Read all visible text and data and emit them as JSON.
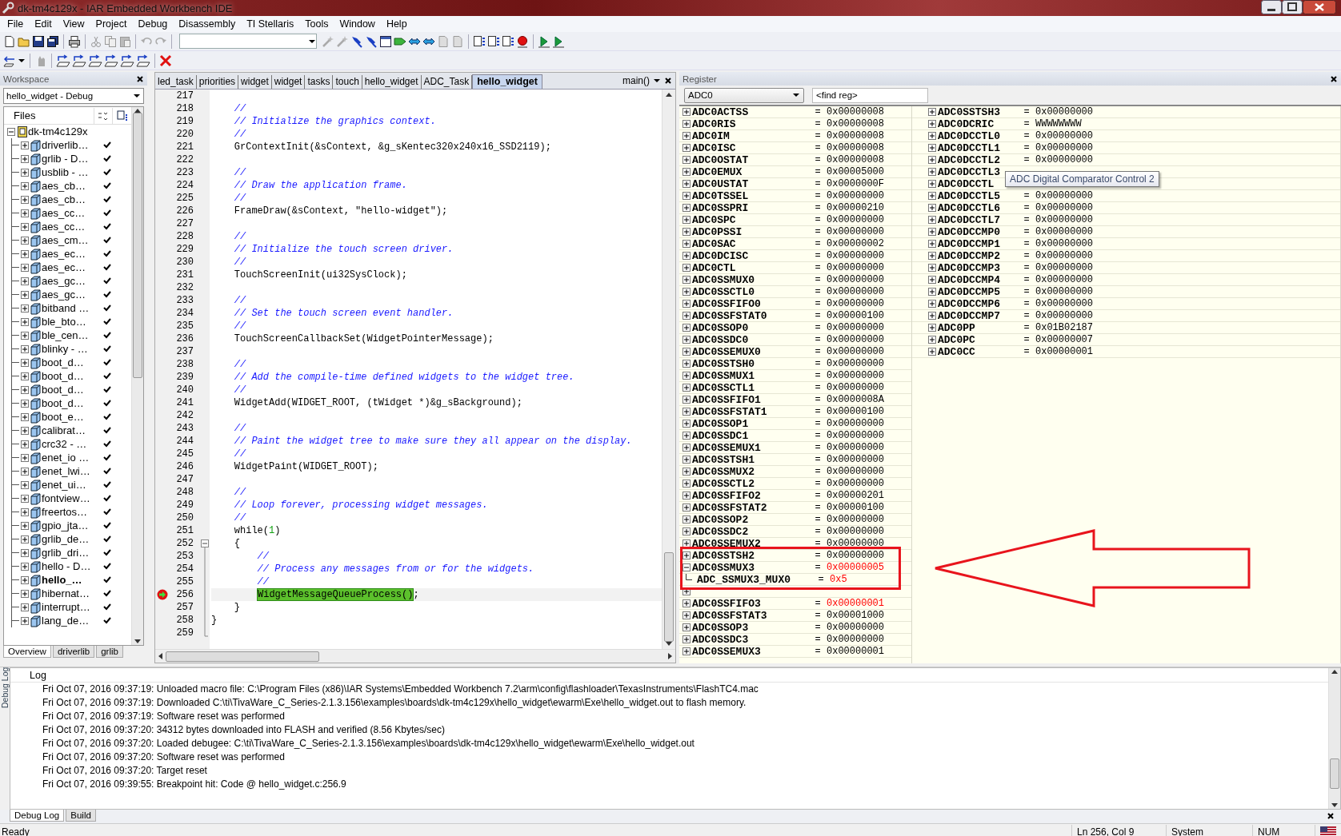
{
  "window": {
    "title": "dk-tm4c129x - IAR Embedded Workbench IDE"
  },
  "menu": [
    "File",
    "Edit",
    "View",
    "Project",
    "Debug",
    "Disassembly",
    "TI Stellaris",
    "Tools",
    "Window",
    "Help"
  ],
  "workspace": {
    "title": "Workspace",
    "configuration": "hello_widget - Debug",
    "column": "Files",
    "tree": {
      "label": "dk-tm4c129x",
      "expanded": true,
      "children": [
        {
          "label": "driverlib…",
          "active": false,
          "checked": true
        },
        {
          "label": "grlib - D…",
          "active": false,
          "checked": true
        },
        {
          "label": "usblib - …",
          "active": false,
          "checked": true
        },
        {
          "label": "aes_cb…",
          "active": false,
          "checked": true
        },
        {
          "label": "aes_cb…",
          "active": false,
          "checked": true
        },
        {
          "label": "aes_cc…",
          "active": false,
          "checked": true
        },
        {
          "label": "aes_cc…",
          "active": false,
          "checked": true
        },
        {
          "label": "aes_cm…",
          "active": false,
          "checked": true
        },
        {
          "label": "aes_ec…",
          "active": false,
          "checked": true
        },
        {
          "label": "aes_ec…",
          "active": false,
          "checked": true
        },
        {
          "label": "aes_gc…",
          "active": false,
          "checked": true
        },
        {
          "label": "aes_gc…",
          "active": false,
          "checked": true
        },
        {
          "label": "bitband …",
          "active": false,
          "checked": true
        },
        {
          "label": "ble_bto…",
          "active": false,
          "checked": true
        },
        {
          "label": "ble_cen…",
          "active": false,
          "checked": true
        },
        {
          "label": "blinky - …",
          "active": false,
          "checked": true
        },
        {
          "label": "boot_d…",
          "active": false,
          "checked": true
        },
        {
          "label": "boot_d…",
          "active": false,
          "checked": true
        },
        {
          "label": "boot_d…",
          "active": false,
          "checked": true
        },
        {
          "label": "boot_d…",
          "active": false,
          "checked": true
        },
        {
          "label": "boot_e…",
          "active": false,
          "checked": true
        },
        {
          "label": "calibrat…",
          "active": false,
          "checked": true
        },
        {
          "label": "crc32 - …",
          "active": false,
          "checked": true
        },
        {
          "label": "enet_io …",
          "active": false,
          "checked": true
        },
        {
          "label": "enet_lwi…",
          "active": false,
          "checked": true
        },
        {
          "label": "enet_ui…",
          "active": false,
          "checked": true
        },
        {
          "label": "fontview…",
          "active": false,
          "checked": true
        },
        {
          "label": "freertos…",
          "active": false,
          "checked": true
        },
        {
          "label": "gpio_jta…",
          "active": false,
          "checked": true
        },
        {
          "label": "grlib_de…",
          "active": false,
          "checked": true
        },
        {
          "label": "grlib_dri…",
          "active": false,
          "checked": true
        },
        {
          "label": "hello - D…",
          "active": false,
          "checked": true
        },
        {
          "label": "hello_…",
          "active": true,
          "checked": true
        },
        {
          "label": "hibernat…",
          "active": false,
          "checked": true
        },
        {
          "label": "interrupt…",
          "active": false,
          "checked": true
        },
        {
          "label": "lang_de…",
          "active": false,
          "checked": true
        }
      ]
    },
    "tabs": [
      {
        "label": "Overview",
        "selected": true
      },
      {
        "label": "driverlib",
        "selected": false
      },
      {
        "label": "grlib",
        "selected": false
      }
    ]
  },
  "editor": {
    "tabs": [
      {
        "label": "led_task",
        "selected": false
      },
      {
        "label": "priorities",
        "selected": false
      },
      {
        "label": "widget",
        "selected": false
      },
      {
        "label": "widget",
        "selected": false
      },
      {
        "label": "tasks",
        "selected": false
      },
      {
        "label": "touch",
        "selected": false
      },
      {
        "label": "hello_widget",
        "selected": false
      },
      {
        "label": "ADC_Task",
        "selected": false
      },
      {
        "label": "hello_widget",
        "selected": true
      }
    ],
    "function": "main()",
    "lines": [
      {
        "n": "217",
        "current": false
      },
      {
        "n": "218",
        "kind": "comment",
        "text": "    //",
        "current": false
      },
      {
        "n": "219",
        "kind": "comment",
        "text": "    // Initialize the graphics context.",
        "current": false
      },
      {
        "n": "220",
        "kind": "comment",
        "text": "    //",
        "current": false
      },
      {
        "n": "221",
        "kind": "code",
        "text": "    GrContextInit(&sContext, &g_sKentec320x240x16_SSD2119);",
        "current": false
      },
      {
        "n": "222",
        "current": false
      },
      {
        "n": "223",
        "kind": "comment",
        "text": "    //",
        "current": false
      },
      {
        "n": "224",
        "kind": "comment",
        "text": "    // Draw the application frame.",
        "current": false
      },
      {
        "n": "225",
        "kind": "comment",
        "text": "    //",
        "current": false
      },
      {
        "n": "226",
        "kind": "code",
        "text": "    FrameDraw(&sContext, \"hello-widget\");",
        "current": false
      },
      {
        "n": "227",
        "current": false
      },
      {
        "n": "228",
        "kind": "comment",
        "text": "    //",
        "current": false
      },
      {
        "n": "229",
        "kind": "comment",
        "text": "    // Initialize the touch screen driver.",
        "current": false
      },
      {
        "n": "230",
        "kind": "comment",
        "text": "    //",
        "current": false
      },
      {
        "n": "231",
        "kind": "code",
        "text": "    TouchScreenInit(ui32SysClock);",
        "current": false
      },
      {
        "n": "232",
        "current": false
      },
      {
        "n": "233",
        "kind": "comment",
        "text": "    //",
        "current": false
      },
      {
        "n": "234",
        "kind": "comment",
        "text": "    // Set the touch screen event handler.",
        "current": false
      },
      {
        "n": "235",
        "kind": "comment",
        "text": "    //",
        "current": false
      },
      {
        "n": "236",
        "kind": "code",
        "text": "    TouchScreenCallbackSet(WidgetPointerMessage);",
        "current": false
      },
      {
        "n": "237",
        "current": false
      },
      {
        "n": "238",
        "kind": "comment",
        "text": "    //",
        "current": false
      },
      {
        "n": "239",
        "kind": "comment",
        "text": "    // Add the compile-time defined widgets to the widget tree.",
        "current": false
      },
      {
        "n": "240",
        "kind": "comment",
        "text": "    //",
        "current": false
      },
      {
        "n": "241",
        "kind": "code",
        "text": "    WidgetAdd(WIDGET_ROOT, (tWidget *)&g_sBackground);",
        "current": false
      },
      {
        "n": "242",
        "current": false
      },
      {
        "n": "243",
        "kind": "comment",
        "text": "    //",
        "current": false
      },
      {
        "n": "244",
        "kind": "comment",
        "text": "    // Paint the widget tree to make sure they all appear on the display.",
        "current": false
      },
      {
        "n": "245",
        "kind": "comment",
        "text": "    //",
        "current": false
      },
      {
        "n": "246",
        "kind": "code",
        "text": "    WidgetPaint(WIDGET_ROOT);",
        "current": false
      },
      {
        "n": "247",
        "current": false
      },
      {
        "n": "248",
        "kind": "comment",
        "text": "    //",
        "current": false
      },
      {
        "n": "249",
        "kind": "comment",
        "text": "    // Loop forever, processing widget messages.",
        "current": false
      },
      {
        "n": "250",
        "kind": "comment",
        "text": "    //",
        "current": false
      },
      {
        "n": "251",
        "kind": "code",
        "parts": [
          {
            "kind": "code",
            "text": "    while("
          },
          {
            "kind": "number",
            "text": "1"
          },
          {
            "kind": "code",
            "text": ")"
          }
        ],
        "current": false
      },
      {
        "n": "252",
        "kind": "code",
        "text": "    {",
        "fold": {
          "kind": "start"
        },
        "current": false
      },
      {
        "n": "253",
        "kind": "comment",
        "text": "        //",
        "fold": {
          "kind": "line"
        },
        "current": false
      },
      {
        "n": "254",
        "kind": "comment",
        "text": "        // Process any messages from or for the widgets.",
        "fold": {
          "kind": "line"
        },
        "current": false
      },
      {
        "n": "255",
        "kind": "comment",
        "text": "        //",
        "fold": {
          "kind": "line"
        },
        "current": false
      },
      {
        "n": "256",
        "kind": "code",
        "indent": {
          "kind": "double"
        },
        "parts": [
          {
            "kind": "statement",
            "text": "WidgetMessageQueueProcess()"
          },
          {
            "kind": "code",
            "text": ";"
          }
        ],
        "fold": {
          "kind": "line"
        },
        "current": true
      },
      {
        "n": "257",
        "kind": "code",
        "text": "    }",
        "fold": {
          "kind": "line"
        },
        "current": false
      },
      {
        "n": "258",
        "kind": "code",
        "text": "}",
        "fold": {
          "kind": "line"
        },
        "current": false
      },
      {
        "n": "259",
        "fold": {
          "kind": "end"
        },
        "current": false
      }
    ]
  },
  "register": {
    "title": "Register",
    "group": "ADC0",
    "find": {
      "placeholder": "<find reg>"
    },
    "columns": [
      [
        {
          "name": "ADC0ACTSS",
          "sep": "=",
          "value": "0x00000008",
          "changed": false,
          "expanded": false,
          "boxed": false
        },
        {
          "name": "ADC0RIS",
          "sep": "=",
          "value": "0x00000008",
          "changed": false,
          "expanded": false,
          "boxed": false
        },
        {
          "name": "ADC0IM",
          "sep": "=",
          "value": "0x00000008",
          "changed": false,
          "expanded": false,
          "boxed": false
        },
        {
          "name": "ADC0ISC",
          "sep": "=",
          "value": "0x00000008",
          "changed": false,
          "expanded": false,
          "boxed": false
        },
        {
          "name": "ADC0OSTAT",
          "sep": "=",
          "value": "0x00000008",
          "changed": false,
          "expanded": false,
          "boxed": false
        },
        {
          "name": "ADC0EMUX",
          "sep": "=",
          "value": "0x00005000",
          "changed": false,
          "expanded": false,
          "boxed": false
        },
        {
          "name": "ADC0USTAT",
          "sep": "=",
          "value": "0x0000000F",
          "changed": false,
          "expanded": false,
          "boxed": false
        },
        {
          "name": "ADC0TSSEL",
          "sep": "=",
          "value": "0x00000000",
          "changed": false,
          "expanded": false,
          "boxed": false
        },
        {
          "name": "ADC0SSPRI",
          "sep": "=",
          "value": "0x00000210",
          "changed": false,
          "expanded": false,
          "boxed": false
        },
        {
          "name": "ADC0SPC",
          "sep": "=",
          "value": "0x00000000",
          "changed": false,
          "expanded": false,
          "boxed": false
        },
        {
          "name": "ADC0PSSI",
          "sep": "=",
          "value": "0x00000000",
          "changed": false,
          "expanded": false,
          "boxed": false
        },
        {
          "name": "ADC0SAC",
          "sep": "=",
          "value": "0x00000002",
          "changed": false,
          "expanded": false,
          "boxed": false
        },
        {
          "name": "ADC0DCISC",
          "sep": "=",
          "value": "0x00000000",
          "changed": false,
          "expanded": false,
          "boxed": false
        },
        {
          "name": "ADC0CTL",
          "sep": "=",
          "value": "0x00000000",
          "changed": false,
          "expanded": false,
          "boxed": false
        },
        {
          "name": "ADC0SSMUX0",
          "sep": "=",
          "value": "0x00000000",
          "changed": false,
          "expanded": false,
          "boxed": false
        },
        {
          "name": "ADC0SSCTL0",
          "sep": "=",
          "value": "0x00000000",
          "changed": false,
          "expanded": false,
          "boxed": false
        },
        {
          "name": "ADC0SSFIFO0",
          "sep": "=",
          "value": "0x00000000",
          "changed": false,
          "expanded": false,
          "boxed": false
        },
        {
          "name": "ADC0SSFSTAT0",
          "sep": "=",
          "value": "0x00000100",
          "changed": false,
          "expanded": false,
          "boxed": false
        },
        {
          "name": "ADC0SSOP0",
          "sep": "=",
          "value": "0x00000000",
          "changed": false,
          "expanded": false,
          "boxed": false
        },
        {
          "name": "ADC0SSDC0",
          "sep": "=",
          "value": "0x00000000",
          "changed": false,
          "expanded": false,
          "boxed": false
        },
        {
          "name": "ADC0SSEMUX0",
          "sep": "=",
          "value": "0x00000000",
          "changed": false,
          "expanded": false,
          "boxed": false
        },
        {
          "name": "ADC0SSTSH0",
          "sep": "=",
          "value": "0x00000000",
          "changed": false,
          "expanded": false,
          "boxed": false
        },
        {
          "name": "ADC0SSMUX1",
          "sep": "=",
          "value": "0x00000000",
          "changed": false,
          "expanded": false,
          "boxed": false
        },
        {
          "name": "ADC0SSCTL1",
          "sep": "=",
          "value": "0x00000000",
          "changed": false,
          "expanded": false,
          "boxed": false
        },
        {
          "name": "ADC0SSFIFO1",
          "sep": "=",
          "value": "0x0000008A",
          "changed": false,
          "expanded": false,
          "boxed": false
        },
        {
          "name": "ADC0SSFSTAT1",
          "sep": "=",
          "value": "0x00000100",
          "changed": false,
          "expanded": false,
          "boxed": false
        },
        {
          "name": "ADC0SSOP1",
          "sep": "=",
          "value": "0x00000000",
          "changed": false,
          "expanded": false,
          "boxed": false
        },
        {
          "name": "ADC0SSDC1",
          "sep": "=",
          "value": "0x00000000",
          "changed": false,
          "expanded": false,
          "boxed": false
        },
        {
          "name": "ADC0SSEMUX1",
          "sep": "=",
          "value": "0x00000000",
          "changed": false,
          "expanded": false,
          "boxed": false
        },
        {
          "name": "ADC0SSTSH1",
          "sep": "=",
          "value": "0x00000000",
          "changed": false,
          "expanded": false,
          "boxed": false
        },
        {
          "name": "ADC0SSMUX2",
          "sep": "=",
          "value": "0x00000000",
          "changed": false,
          "expanded": false,
          "boxed": false
        },
        {
          "name": "ADC0SSCTL2",
          "sep": "=",
          "value": "0x00000000",
          "changed": false,
          "expanded": false,
          "boxed": false
        },
        {
          "name": "ADC0SSFIFO2",
          "sep": "=",
          "value": "0x00000201",
          "changed": false,
          "expanded": false,
          "boxed": false
        },
        {
          "name": "ADC0SSFSTAT2",
          "sep": "=",
          "value": "0x00000100",
          "changed": false,
          "expanded": false,
          "boxed": false
        },
        {
          "name": "ADC0SSOP2",
          "sep": "=",
          "value": "0x00000000",
          "changed": false,
          "expanded": false,
          "boxed": false
        },
        {
          "name": "ADC0SSDC2",
          "sep": "=",
          "value": "0x00000000",
          "changed": false,
          "expanded": false,
          "boxed": false
        },
        {
          "name": "ADC0SSEMUX2",
          "sep": "=",
          "value": "0x00000000",
          "changed": false,
          "expanded": false,
          "boxed": false
        },
        {
          "name": "ADC0SSTSH2",
          "sep": "=",
          "value": "0x00000000",
          "changed": false,
          "expanded": false,
          "boxed": true
        },
        {
          "name": "ADC0SSMUX3",
          "sep": "=",
          "value": "0x00000005",
          "changed": true,
          "expanded": true,
          "boxed": true,
          "children": [
            {
              "name": "ADC_SSMUX3_MUX0",
              "sep": "=",
              "value": "0x5",
              "changed": true,
              "boxed": true
            }
          ]
        },
        {
          "expanded": false,
          "boxed": false
        },
        {
          "name": "ADC0SSFIFO3",
          "sep": "=",
          "value": "0x00000001",
          "changed": true,
          "expanded": false,
          "boxed": false
        },
        {
          "name": "ADC0SSFSTAT3",
          "sep": "=",
          "value": "0x00001000",
          "changed": false,
          "expanded": false,
          "boxed": false
        },
        {
          "name": "ADC0SSOP3",
          "sep": "=",
          "value": "0x00000000",
          "changed": false,
          "expanded": false,
          "boxed": false
        },
        {
          "name": "ADC0SSDC3",
          "sep": "=",
          "value": "0x00000000",
          "changed": false,
          "expanded": false,
          "boxed": false
        },
        {
          "name": "ADC0SSEMUX3",
          "sep": "=",
          "value": "0x00000001",
          "changed": false,
          "expanded": false,
          "boxed": false
        }
      ],
      [
        {
          "name": "ADC0SSTSH3",
          "sep": "=",
          "value": "0x00000000",
          "changed": false,
          "expanded": false
        },
        {
          "name": "ADC0DCRIC",
          "sep": "=",
          "value": "WWWWWWWW",
          "changed": false,
          "expanded": false
        },
        {
          "name": "ADC0DCCTL0",
          "sep": "=",
          "value": "0x00000000",
          "changed": false,
          "expanded": false
        },
        {
          "name": "ADC0DCCTL1",
          "sep": "=",
          "value": "0x00000000",
          "changed": false,
          "expanded": false
        },
        {
          "name": "ADC0DCCTL2",
          "sep": "=",
          "value": "0x00000000",
          "changed": false,
          "expanded": false
        },
        {
          "name": "ADC0DCCTL3",
          "expanded": false,
          "tooltip": "ADC Digital Comparator Control 2"
        },
        {
          "name": "ADC0DCCTL",
          "expanded": false
        },
        {
          "name": "ADC0DCCTL5",
          "sep": "=",
          "value": "0x00000000",
          "changed": false,
          "expanded": false
        },
        {
          "name": "ADC0DCCTL6",
          "sep": "=",
          "value": "0x00000000",
          "changed": false,
          "expanded": false
        },
        {
          "name": "ADC0DCCTL7",
          "sep": "=",
          "value": "0x00000000",
          "changed": false,
          "expanded": false
        },
        {
          "name": "ADC0DCCMP0",
          "sep": "=",
          "value": "0x00000000",
          "changed": false,
          "expanded": false
        },
        {
          "name": "ADC0DCCMP1",
          "sep": "=",
          "value": "0x00000000",
          "changed": false,
          "expanded": false
        },
        {
          "name": "ADC0DCCMP2",
          "sep": "=",
          "value": "0x00000000",
          "changed": false,
          "expanded": false
        },
        {
          "name": "ADC0DCCMP3",
          "sep": "=",
          "value": "0x00000000",
          "changed": false,
          "expanded": false
        },
        {
          "name": "ADC0DCCMP4",
          "sep": "=",
          "value": "0x00000000",
          "changed": false,
          "expanded": false
        },
        {
          "name": "ADC0DCCMP5",
          "sep": "=",
          "value": "0x00000000",
          "changed": false,
          "expanded": false
        },
        {
          "name": "ADC0DCCMP6",
          "sep": "=",
          "value": "0x00000000",
          "changed": false,
          "expanded": false
        },
        {
          "name": "ADC0DCCMP7",
          "sep": "=",
          "value": "0x00000000",
          "changed": false,
          "expanded": false
        },
        {
          "name": "ADC0PP",
          "sep": "=",
          "value": "0x01B02187",
          "changed": false,
          "expanded": false
        },
        {
          "name": "ADC0PC",
          "sep": "=",
          "value": "0x00000007",
          "changed": false,
          "expanded": false
        },
        {
          "name": "ADC0CC",
          "sep": "=",
          "value": "0x00000001",
          "changed": false,
          "expanded": false
        }
      ]
    ],
    "annotations": {
      "rectangle": {
        "color": "#e8141c"
      },
      "arrow": {
        "color": "#e8141c"
      }
    }
  },
  "log": {
    "side_label": "Debug Log",
    "header": "Log",
    "lines": [
      "Fri Oct 07, 2016 09:37:19: Unloaded macro file: C:\\Program Files (x86)\\IAR Systems\\Embedded Workbench 7.2\\arm\\config\\flashloader\\TexasInstruments\\FlashTC4.mac",
      "Fri Oct 07, 2016 09:37:19: Downloaded C:\\ti\\TivaWare_C_Series-2.1.3.156\\examples\\boards\\dk-tm4c129x\\hello_widget\\ewarm\\Exe\\hello_widget.out to flash memory.",
      "Fri Oct 07, 2016 09:37:19: Software reset was performed",
      "Fri Oct 07, 2016 09:37:20: 34312 bytes downloaded into FLASH and verified (8.56 Kbytes/sec)",
      "Fri Oct 07, 2016 09:37:20: Loaded debugee: C:\\ti\\TivaWare_C_Series-2.1.3.156\\examples\\boards\\dk-tm4c129x\\hello_widget\\ewarm\\Exe\\hello_widget.out",
      "Fri Oct 07, 2016 09:37:20: Software reset was performed",
      "Fri Oct 07, 2016 09:37:20: Target reset",
      "Fri Oct 07, 2016 09:39:55: Breakpoint hit: Code @ hello_widget.c:256.9"
    ],
    "tabs": [
      {
        "label": "Debug Log",
        "selected": true
      },
      {
        "label": "Build",
        "selected": false
      }
    ]
  },
  "status_bar": {
    "message": "Ready",
    "position": "Ln 256, Col 9",
    "encoding": "System",
    "num_lock": "NUM"
  }
}
